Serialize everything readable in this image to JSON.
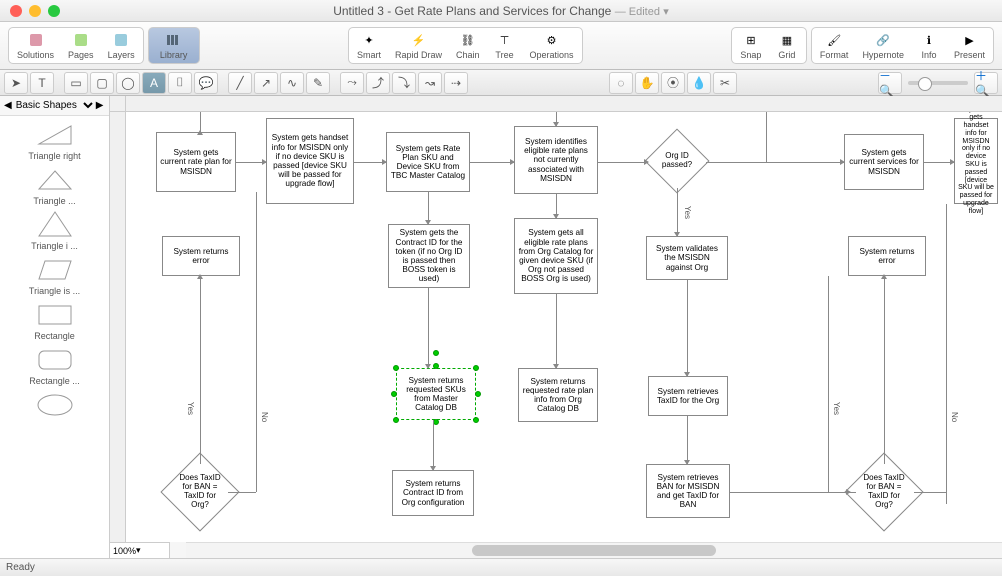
{
  "window": {
    "title": "Untitled 3 - Get Rate Plans and Services for Change",
    "edited": "— Edited",
    "chevron": "▾"
  },
  "toolbar": {
    "left": [
      {
        "label": "Solutions",
        "color": "#d63"
      },
      {
        "label": "Pages",
        "color": "#9c4"
      },
      {
        "label": "Layers",
        "color": "#6bd"
      }
    ],
    "library": "Library",
    "mid": [
      {
        "label": "Smart"
      },
      {
        "label": "Rapid Draw"
      },
      {
        "label": "Chain"
      },
      {
        "label": "Tree"
      },
      {
        "label": "Operations"
      }
    ],
    "snap": "Snap",
    "grid": "Grid",
    "right": [
      {
        "label": "Format"
      },
      {
        "label": "Hypernote"
      },
      {
        "label": "Info"
      },
      {
        "label": "Present"
      }
    ]
  },
  "sidebar": {
    "category": "Basic Shapes",
    "items": [
      "Triangle right",
      "Triangle ...",
      "Triangle i ...",
      "Triangle is ...",
      "Rectangle",
      "Rectangle ..."
    ]
  },
  "canvas": {
    "zoom": "100%",
    "nodes": {
      "n1": "System gets current rate plan for MSISDN",
      "n2": "System gets handset info for MSISDN only if no device SKU is passed [device SKU will be passed for upgrade flow]",
      "n3": "System gets Rate Plan SKU and Device SKU from TBC Master Catalog",
      "n4": "System identifies eligible rate plans not currently associated with MSISDN",
      "d1": "Org ID passed?",
      "n5": "System gets current services for MSISDN",
      "n6": "System gets handset info for MSISDN only if no device SKU is passed [device SKU will be passed for upgrade flow]",
      "e1": "System returns error",
      "n7": "System gets the Contract ID for the token (if no Org ID is passed then BOSS token is used)",
      "n8": "System gets all eligible rate plans from Org Catalog for given device SKU (if Org not passed BOSS Org is used)",
      "n9": "System validates the MSISDN against Org",
      "e2": "System returns error",
      "n10": "System returns requested SKUs from Master Catalog DB",
      "n11": "System returns requested rate plan info from Org Catalog DB",
      "n12": "System retrieves TaxID for the Org",
      "d2": "Does TaxID for BAN = TaxID for Org?",
      "n13": "System returns Contract ID from Org configuration",
      "n14": "System retrieves BAN for MSISDN and get TaxID for BAN",
      "d3": "Does TaxID for BAN = TaxID for Org?"
    },
    "labels": {
      "yes": "Yes",
      "no": "No"
    }
  },
  "status": {
    "ready": "Ready"
  },
  "chart_data": {
    "type": "flowchart",
    "nodes": [
      {
        "id": "n1",
        "type": "process",
        "text": "System gets current rate plan for MSISDN"
      },
      {
        "id": "n2",
        "type": "process",
        "text": "System gets handset info for MSISDN only if no device SKU is passed [device SKU will be passed for upgrade flow]"
      },
      {
        "id": "n3",
        "type": "process",
        "text": "System gets Rate Plan SKU and Device SKU from TBC Master Catalog"
      },
      {
        "id": "n4",
        "type": "process",
        "text": "System identifies eligible rate plans not currently associated with MSISDN"
      },
      {
        "id": "d1",
        "type": "decision",
        "text": "Org ID passed?"
      },
      {
        "id": "n5",
        "type": "process",
        "text": "System gets current services for MSISDN"
      },
      {
        "id": "n6",
        "type": "process",
        "text": "System gets handset info for MSISDN only if no device SKU is passed [device SKU will be passed for upgrade flow]"
      },
      {
        "id": "e1",
        "type": "document",
        "text": "System returns error"
      },
      {
        "id": "n7",
        "type": "process",
        "text": "System gets the Contract ID for the token (if no Org ID is passed then BOSS token is used)"
      },
      {
        "id": "n8",
        "type": "process",
        "text": "System gets all eligible rate plans from Org Catalog for given device SKU (if Org not passed BOSS Org is used)"
      },
      {
        "id": "n9",
        "type": "process",
        "text": "System validates the MSISDN against Org"
      },
      {
        "id": "e2",
        "type": "document",
        "text": "System returns error"
      },
      {
        "id": "n10",
        "type": "process",
        "text": "System returns requested SKUs from Master Catalog DB",
        "selected": true
      },
      {
        "id": "n11",
        "type": "process",
        "text": "System returns requested rate plan info from Org Catalog DB"
      },
      {
        "id": "n12",
        "type": "process",
        "text": "System retrieves TaxID for the Org"
      },
      {
        "id": "d2",
        "type": "decision",
        "text": "Does TaxID for BAN = TaxID for Org?"
      },
      {
        "id": "n13",
        "type": "process",
        "text": "System returns Contract ID from Org configuration"
      },
      {
        "id": "n14",
        "type": "process",
        "text": "System retrieves BAN for MSISDN and get TaxID for BAN"
      },
      {
        "id": "d3",
        "type": "decision",
        "text": "Does TaxID for BAN = TaxID for Org?"
      }
    ],
    "edges": [
      {
        "from": "n1",
        "to": "n2"
      },
      {
        "from": "n2",
        "to": "n3"
      },
      {
        "from": "n3",
        "to": "n4"
      },
      {
        "from": "n4",
        "to": "d1"
      },
      {
        "from": "d1",
        "to": "n5"
      },
      {
        "from": "n5",
        "to": "n6"
      },
      {
        "from": "d1",
        "to": "n9",
        "label": "Yes"
      },
      {
        "from": "n9",
        "to": "n12"
      },
      {
        "from": "n12",
        "to": "n14"
      },
      {
        "from": "n3",
        "to": "n7"
      },
      {
        "from": "n7",
        "to": "n10"
      },
      {
        "from": "n4",
        "to": "n8"
      },
      {
        "from": "n8",
        "to": "n11"
      },
      {
        "from": "n14",
        "to": "d3"
      },
      {
        "from": "d3",
        "to": "e2",
        "label": "No"
      },
      {
        "from": "d3",
        "to": "n5",
        "label": "Yes"
      },
      {
        "from": "d2",
        "to": "e1",
        "label": "No"
      },
      {
        "from": "d2",
        "to": "n1",
        "label": "Yes"
      },
      {
        "from": "n10",
        "to": "n13"
      }
    ]
  }
}
